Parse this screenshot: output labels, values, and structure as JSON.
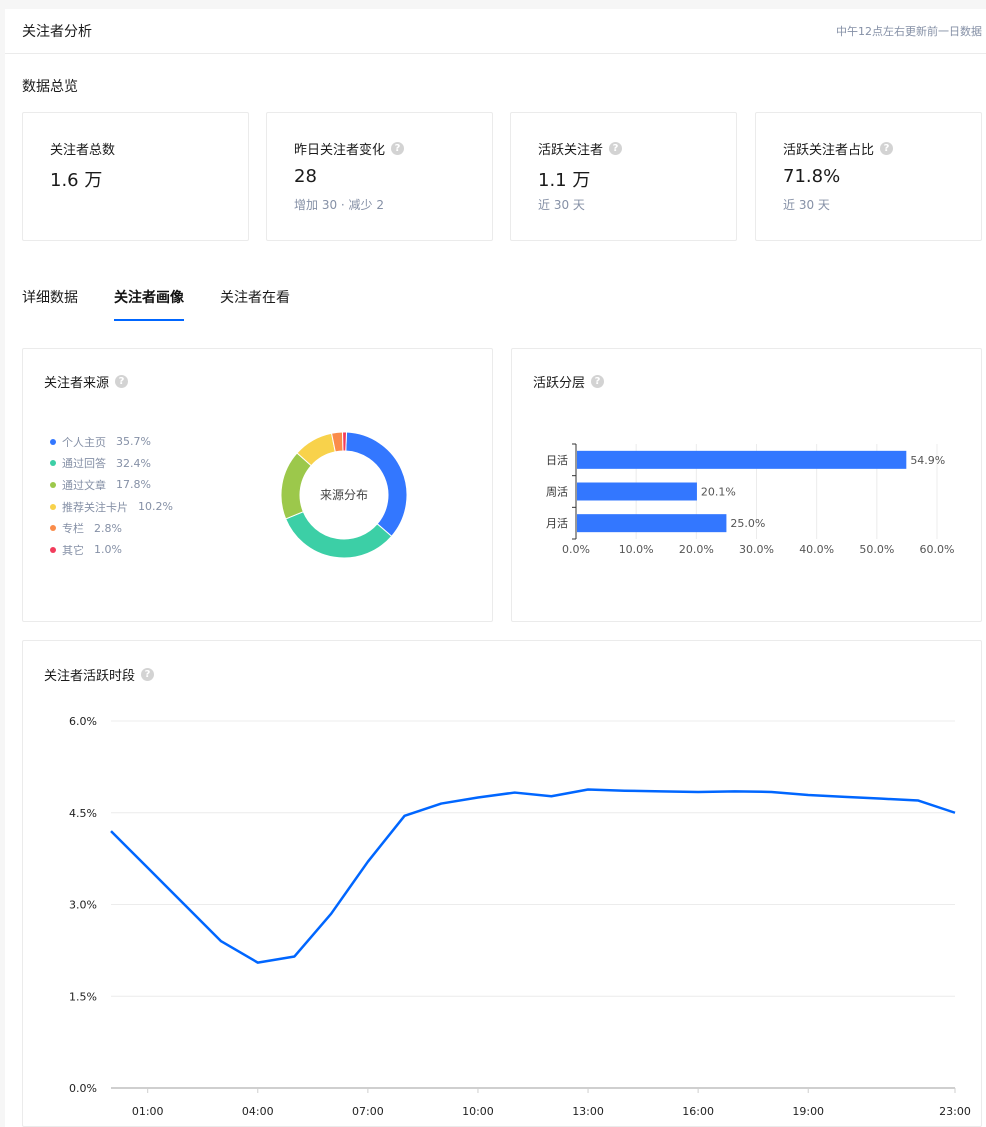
{
  "header": {
    "title": "关注者分析",
    "note": "中午12点左右更新前一日数据"
  },
  "overview": {
    "title": "数据总览",
    "cards": [
      {
        "label": "关注者总数",
        "value": "1.6 万",
        "sub": "",
        "help": false
      },
      {
        "label": "昨日关注者变化",
        "value": "28",
        "sub": "增加 30 · 减少 2",
        "help": true
      },
      {
        "label": "活跃关注者",
        "value": "1.1 万",
        "sub": "近 30 天",
        "help": true
      },
      {
        "label": "活跃关注者占比",
        "value": "71.8%",
        "sub": "近 30 天",
        "help": true
      }
    ]
  },
  "tabs": [
    {
      "label": "详细数据",
      "active": false
    },
    {
      "label": "关注者画像",
      "active": true
    },
    {
      "label": "关注者在看",
      "active": false
    }
  ],
  "help_glyph": "?",
  "colors": {
    "accent": "#0066ff",
    "bar": "#3377ff",
    "line": "#0066ff",
    "muted": "#8590a6"
  },
  "chart_data": [
    {
      "type": "pie",
      "title": "关注者来源",
      "center_label": "来源分布",
      "categories": [
        "个人主页",
        "通过回答",
        "通过文章",
        "推荐关注卡片",
        "专栏",
        "其它"
      ],
      "values": [
        35.7,
        32.4,
        17.8,
        10.2,
        2.8,
        1.0
      ],
      "value_labels": [
        "35.7%",
        "32.4%",
        "17.8%",
        "10.2%",
        "2.8%",
        "1.0%"
      ],
      "colors": [
        "#3377ff",
        "#3ccfa6",
        "#9cc84b",
        "#f8d24b",
        "#fa8c4a",
        "#f23c5c"
      ],
      "legend": "left"
    },
    {
      "type": "bar",
      "orientation": "horizontal",
      "title": "活跃分层",
      "categories": [
        "日活",
        "周活",
        "月活"
      ],
      "values": [
        54.9,
        20.1,
        25.0
      ],
      "value_labels": [
        "54.9%",
        "20.1%",
        "25.0%"
      ],
      "xlim": [
        0,
        60
      ],
      "xticks": [
        "0.0%",
        "10.0%",
        "20.0%",
        "30.0%",
        "40.0%",
        "50.0%",
        "60.0%"
      ],
      "grid": true
    },
    {
      "type": "line",
      "title": "关注者活跃时段",
      "x": [
        "00:00",
        "01:00",
        "02:00",
        "03:00",
        "04:00",
        "05:00",
        "06:00",
        "07:00",
        "08:00",
        "09:00",
        "10:00",
        "11:00",
        "12:00",
        "13:00",
        "14:00",
        "15:00",
        "16:00",
        "17:00",
        "18:00",
        "19:00",
        "20:00",
        "21:00",
        "22:00",
        "23:00"
      ],
      "values": [
        4.2,
        3.6,
        3.0,
        2.4,
        2.05,
        2.15,
        2.85,
        3.7,
        4.45,
        4.65,
        4.75,
        4.83,
        4.77,
        4.88,
        4.86,
        4.85,
        4.84,
        4.85,
        4.84,
        4.79,
        4.76,
        4.73,
        4.7,
        4.5
      ],
      "xticks": [
        "01:00",
        "04:00",
        "07:00",
        "10:00",
        "13:00",
        "16:00",
        "19:00",
        "23:00"
      ],
      "ylim": [
        0,
        6
      ],
      "yticks": [
        "0.0%",
        "1.5%",
        "3.0%",
        "4.5%",
        "6.0%"
      ],
      "grid": true
    }
  ]
}
